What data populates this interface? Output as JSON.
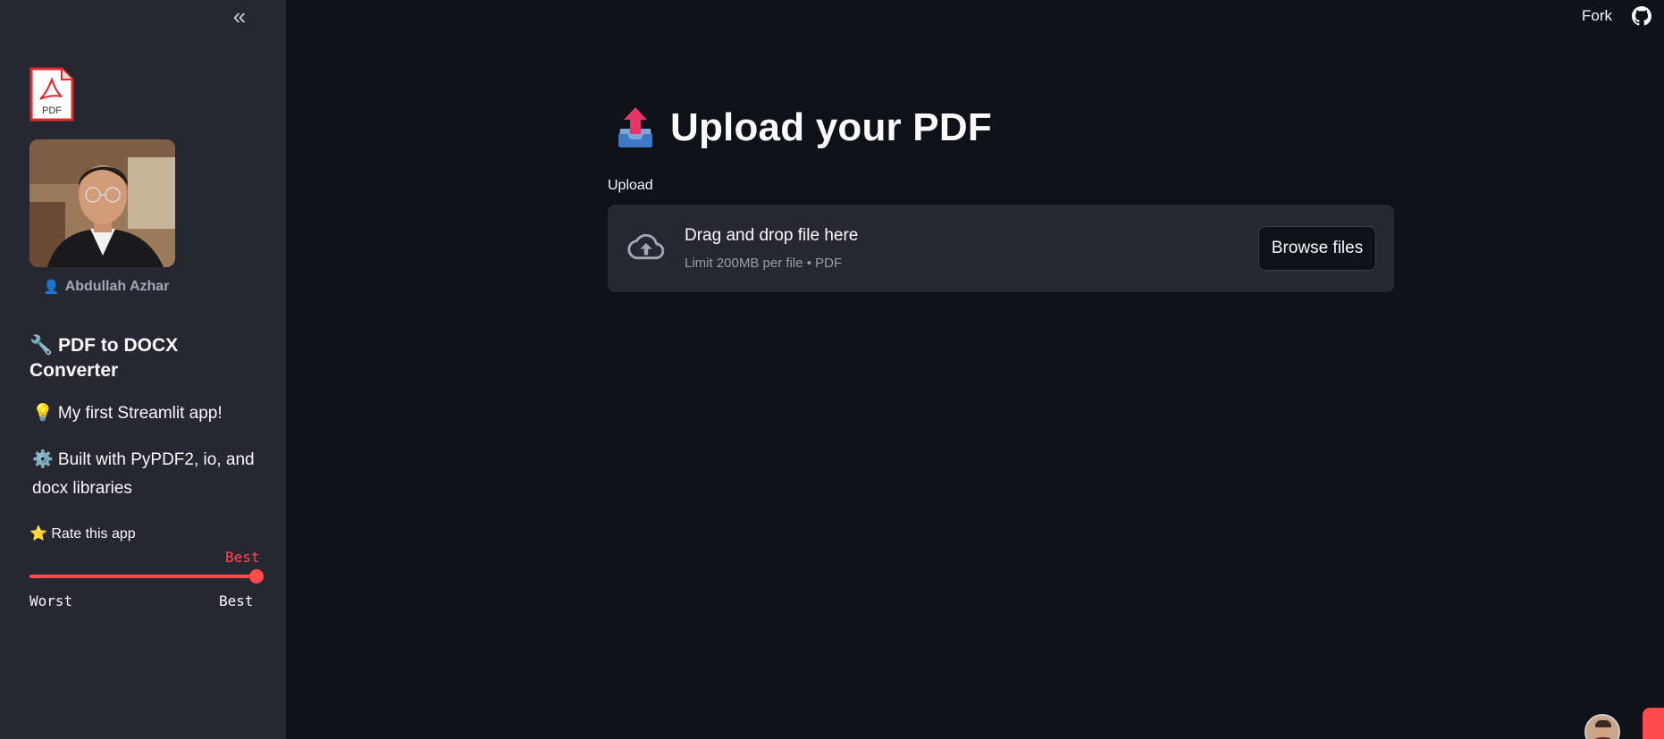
{
  "sidebar": {
    "author": "Abdullah Azhar",
    "app_title": "🔧 PDF to DOCX Converter",
    "first_app": "💡 My first Streamlit app!",
    "built_with": "⚙️ Built with PyPDF2, io, and docx libraries",
    "pdf_logo_text": "PDF",
    "rating": {
      "label": "⭐ Rate this app",
      "value_label": "Best",
      "min_label": "Worst",
      "max_label": "Best",
      "fraction": 1.0
    }
  },
  "header": {
    "fork_label": "Fork",
    "github_icon": "github-icon",
    "collapse_icon": "double-chevron-left-icon"
  },
  "main": {
    "title": "Upload your PDF",
    "title_icon": "outbox-tray-icon",
    "uploader": {
      "label": "Upload",
      "drag_text": "Drag and drop file here",
      "limit_text": "Limit 200MB per file • PDF",
      "browse_label": "Browse files",
      "icon": "cloud-upload-icon"
    }
  },
  "colors": {
    "background": "#0e1117",
    "sidebar": "#262730",
    "accent": "#ff4b4b",
    "text": "#fafafa"
  }
}
